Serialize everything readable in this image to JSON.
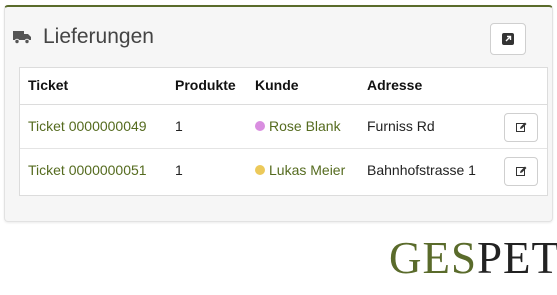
{
  "panel": {
    "title": "Lieferungen",
    "icon": "truck-icon",
    "export_icon": "external-link-icon"
  },
  "table": {
    "columns": [
      "Ticket",
      "Produkte",
      "Kunde",
      "Adresse"
    ],
    "rows": [
      {
        "ticket": "Ticket 0000000049",
        "products": "1",
        "customer": "Rose Blank",
        "customer_color": "#d98ee0",
        "address": "Furniss Rd"
      },
      {
        "ticket": "Ticket 0000000051",
        "products": "1",
        "customer": "Lukas Meier",
        "customer_color": "#ecc95a",
        "address": "Bahnhofstrasse 1"
      }
    ],
    "edit_icon": "edit-icon"
  },
  "logo": {
    "part1": "GES",
    "part2": "PET"
  },
  "colors": {
    "accent": "#5a6b2b",
    "link": "#556b1f"
  }
}
